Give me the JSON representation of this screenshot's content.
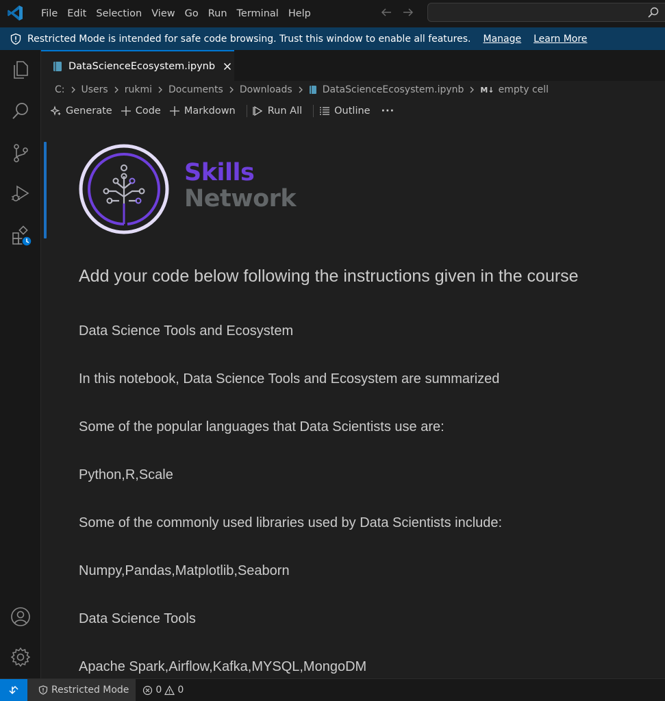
{
  "menu": [
    "File",
    "Edit",
    "Selection",
    "View",
    "Go",
    "Run",
    "Terminal",
    "Help"
  ],
  "banner": {
    "message": "Restricted Mode is intended for safe code browsing. Trust this window to enable all features.",
    "manage": "Manage",
    "learn_more": "Learn More"
  },
  "tab": {
    "label": "DataScienceEcosystem.ipynb"
  },
  "breadcrumb": [
    "C:",
    "Users",
    "rukmi",
    "Documents",
    "Downloads",
    "DataScienceEcosystem.ipynb",
    "empty cell"
  ],
  "breadcrumb_md": "M↓",
  "toolbar": {
    "generate": "Generate",
    "code": "Code",
    "markdown": "Markdown",
    "run_all": "Run All",
    "outline": "Outline",
    "more": "···"
  },
  "logo": {
    "line1": "Skills",
    "line2": "Network"
  },
  "notebook": {
    "heading": "Add your code below following the instructions given in the course",
    "lines": [
      "Data Science Tools and Ecosystem",
      "In this notebook, Data Science Tools and Ecosystem are summarized",
      "Some of the popular languages that Data Scientists use are:",
      "Python,R,Scale",
      "Some of the commonly used libraries used by Data Scientists include:",
      "Numpy,Pandas,Matplotlib,Seaborn",
      "Data Science Tools",
      "Apache Spark,Airflow,Kafka,MYSQL,MongoDM"
    ]
  },
  "status": {
    "restricted": "Restricted Mode",
    "errors": "0",
    "warnings": "0"
  },
  "colors": {
    "accent": "#0078d4",
    "banner": "#0d3b5e",
    "skills_purple": "#6e3fdb"
  }
}
